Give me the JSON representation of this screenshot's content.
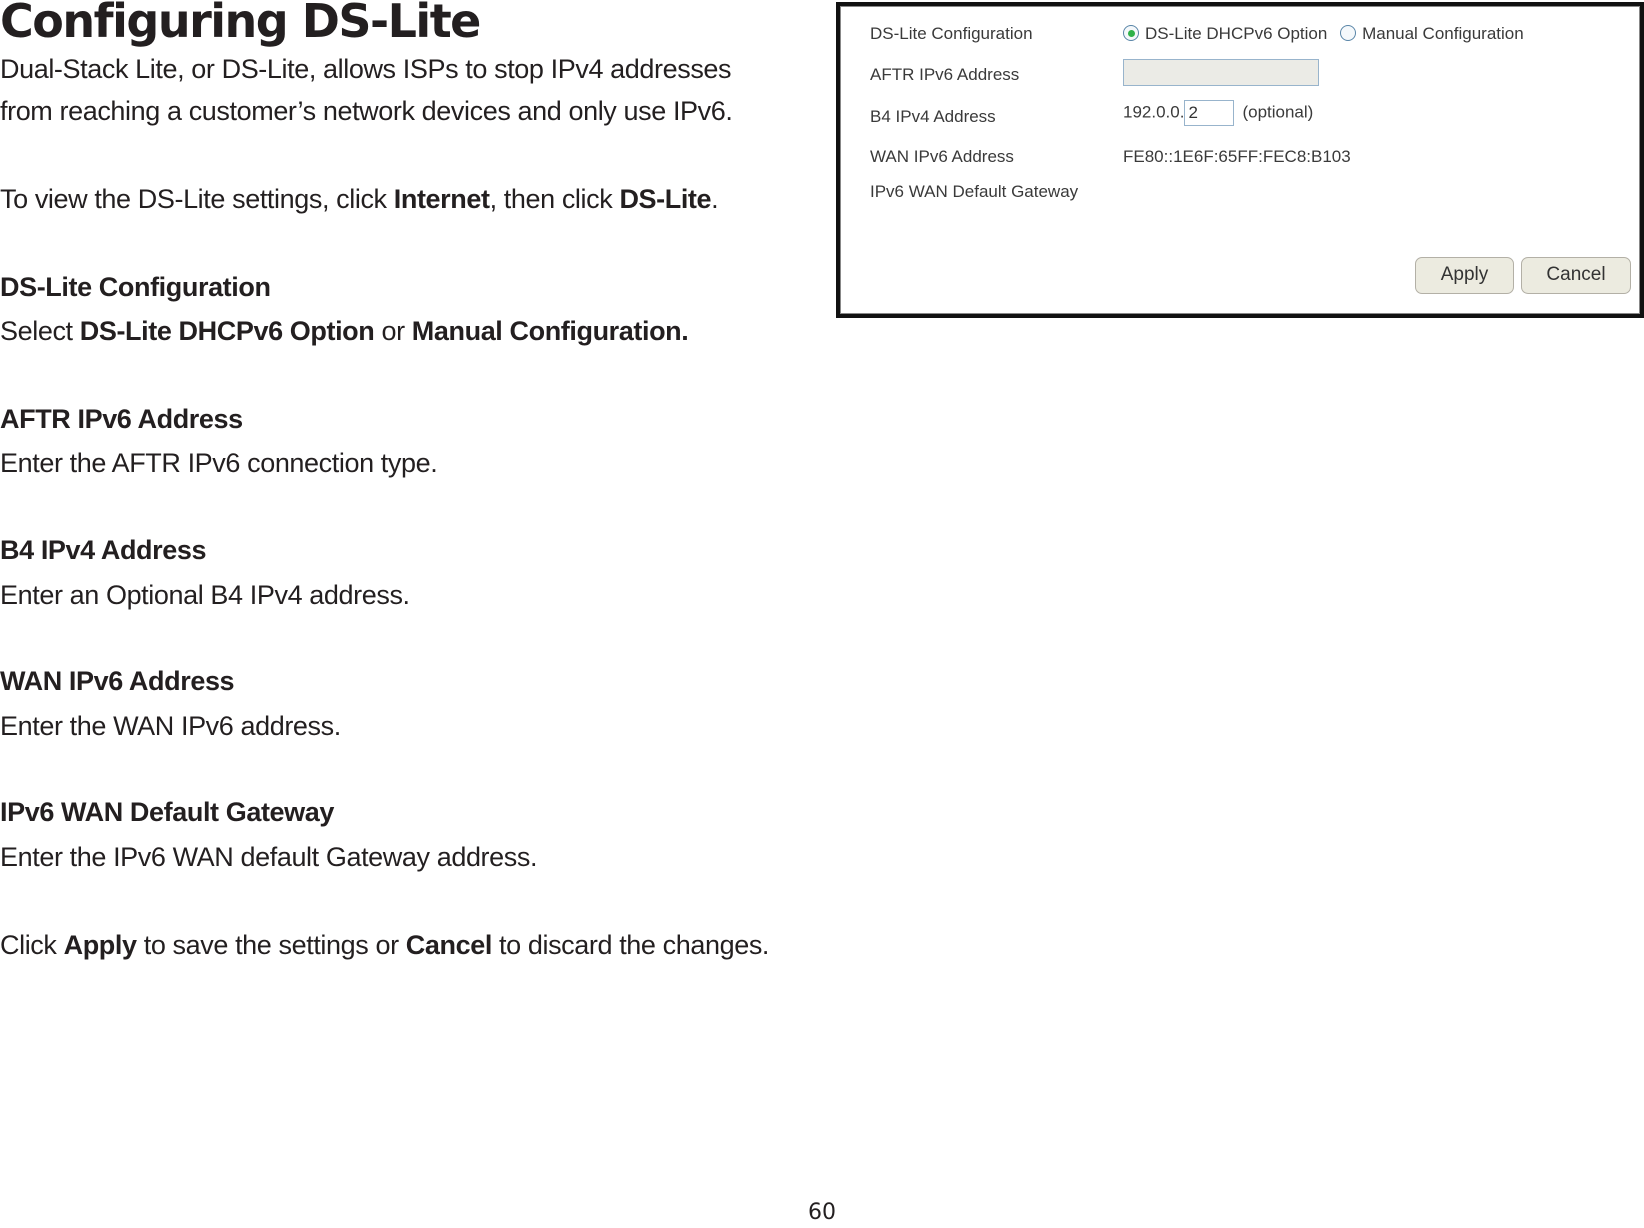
{
  "document": {
    "title": "Configuring DS-Lite",
    "intro_line1": "Dual-Stack Lite, or DS-Lite, allows ISPs to stop IPv4 addresses",
    "intro_line2": "from reaching a customer’s network devices and only use IPv6.",
    "view": {
      "prefix": "To view the DS-Lite settings, click ",
      "bold1": "Internet",
      "middle": ", then click ",
      "bold2": "DS-Lite",
      "suffix": "."
    },
    "sections": {
      "dslite_config": {
        "heading": "DS-Lite Configuration",
        "prefix": "Select ",
        "bold1": "DS-Lite DHCPv6 Option",
        "middle": " or ",
        "bold2": "Manual Configuration."
      },
      "aftr": {
        "heading": "AFTR IPv6 Address",
        "text": "Enter the AFTR IPv6 connection type."
      },
      "b4": {
        "heading": "B4 IPv4 Address",
        "text": "Enter an Optional B4 IPv4 address."
      },
      "wan": {
        "heading": "WAN IPv6 Address",
        "text": "Enter the WAN IPv6 address."
      },
      "gateway": {
        "heading": "IPv6 WAN Default Gateway",
        "text": "Enter the IPv6 WAN default Gateway address."
      }
    },
    "closing": {
      "prefix": "Click ",
      "bold1": "Apply",
      "middle": " to save the settings or ",
      "bold2": "Cancel",
      "suffix": " to discard the changes."
    },
    "page_number": "60"
  },
  "screenshot": {
    "rows": {
      "dslite_config_label": "DS-Lite Configuration",
      "aftr_label": "AFTR IPv6 Address",
      "b4_label": "B4 IPv4 Address",
      "wan_label": "WAN IPv6 Address",
      "gateway_label": "IPv6 WAN Default Gateway"
    },
    "radio_options": {
      "dhcpv6": {
        "label": "DS-Lite DHCPv6 Option",
        "selected": true
      },
      "manual": {
        "label": "Manual Configuration",
        "selected": false
      }
    },
    "aftr_value": "",
    "b4_prefix": "192.0.0.",
    "b4_value": "2",
    "b4_hint": "(optional)",
    "wan_value": "FE80::1E6F:65FF:FEC8:B103",
    "gateway_value": "",
    "apply_label": "Apply",
    "cancel_label": "Cancel",
    "colors": {
      "radio_selected": "#2fb24a",
      "input_border": "#98b4cc",
      "button_bg": "#ecebe0"
    }
  }
}
